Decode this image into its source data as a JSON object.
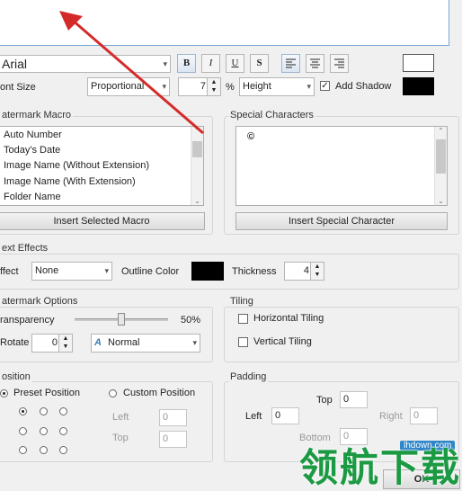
{
  "font": {
    "family_value": "Arial",
    "bold": "B",
    "italic": "I",
    "underline": "U",
    "strike": "S",
    "font_size_label": "ont Size",
    "font_size_mode": "Proportional",
    "size_value": "7",
    "percent": "%",
    "height_mode": "Height",
    "add_shadow_label": "Add Shadow",
    "add_shadow_checked": "✓",
    "text_color": "#ffffff",
    "shadow_color": "#000000"
  },
  "macro": {
    "title": "atermark Macro",
    "items": [
      "Auto Number",
      "Today's Date",
      "Image Name (Without Extension)",
      "Image Name (With Extension)",
      "Folder Name"
    ],
    "insert_button": "Insert Selected Macro"
  },
  "special": {
    "title": "Special Characters",
    "char": "©",
    "insert_button": "Insert Special Character"
  },
  "text_effects": {
    "title": "ext Effects",
    "effect_label": "ffect",
    "effect_value": "None",
    "outline_label": "Outline Color",
    "outline_color": "#000000",
    "thickness_label": "Thickness",
    "thickness_value": "4"
  },
  "options": {
    "title": "atermark Options",
    "transparency_label": "ransparency",
    "transparency_value": "50%",
    "transparency_level": 0.5,
    "rotate_label": "Rotate",
    "rotate_value": "0",
    "blend_value": "Normal"
  },
  "tiling": {
    "title": "Tiling",
    "horizontal": "Horizontal Tiling",
    "vertical": "Vertical Tiling"
  },
  "position": {
    "title": "osition",
    "preset": "Preset Position",
    "custom": "Custom Position",
    "left_label": "Left",
    "left_value": "0",
    "top_label": "Top",
    "top_value": "0"
  },
  "padding": {
    "title": "Padding",
    "top_label": "Top",
    "top_value": "0",
    "left_label": "Left",
    "left_value": "0",
    "right_label": "Right",
    "right_value": "0",
    "bottom_label": "Bottom",
    "bottom_value": "0"
  },
  "footer": {
    "ok_button": "OK",
    "watermark_site": "lhdown.com",
    "watermark_text": "领航下载"
  },
  "colors": {
    "arrow": "#d42a2a",
    "accent": "#3c7fb1"
  }
}
